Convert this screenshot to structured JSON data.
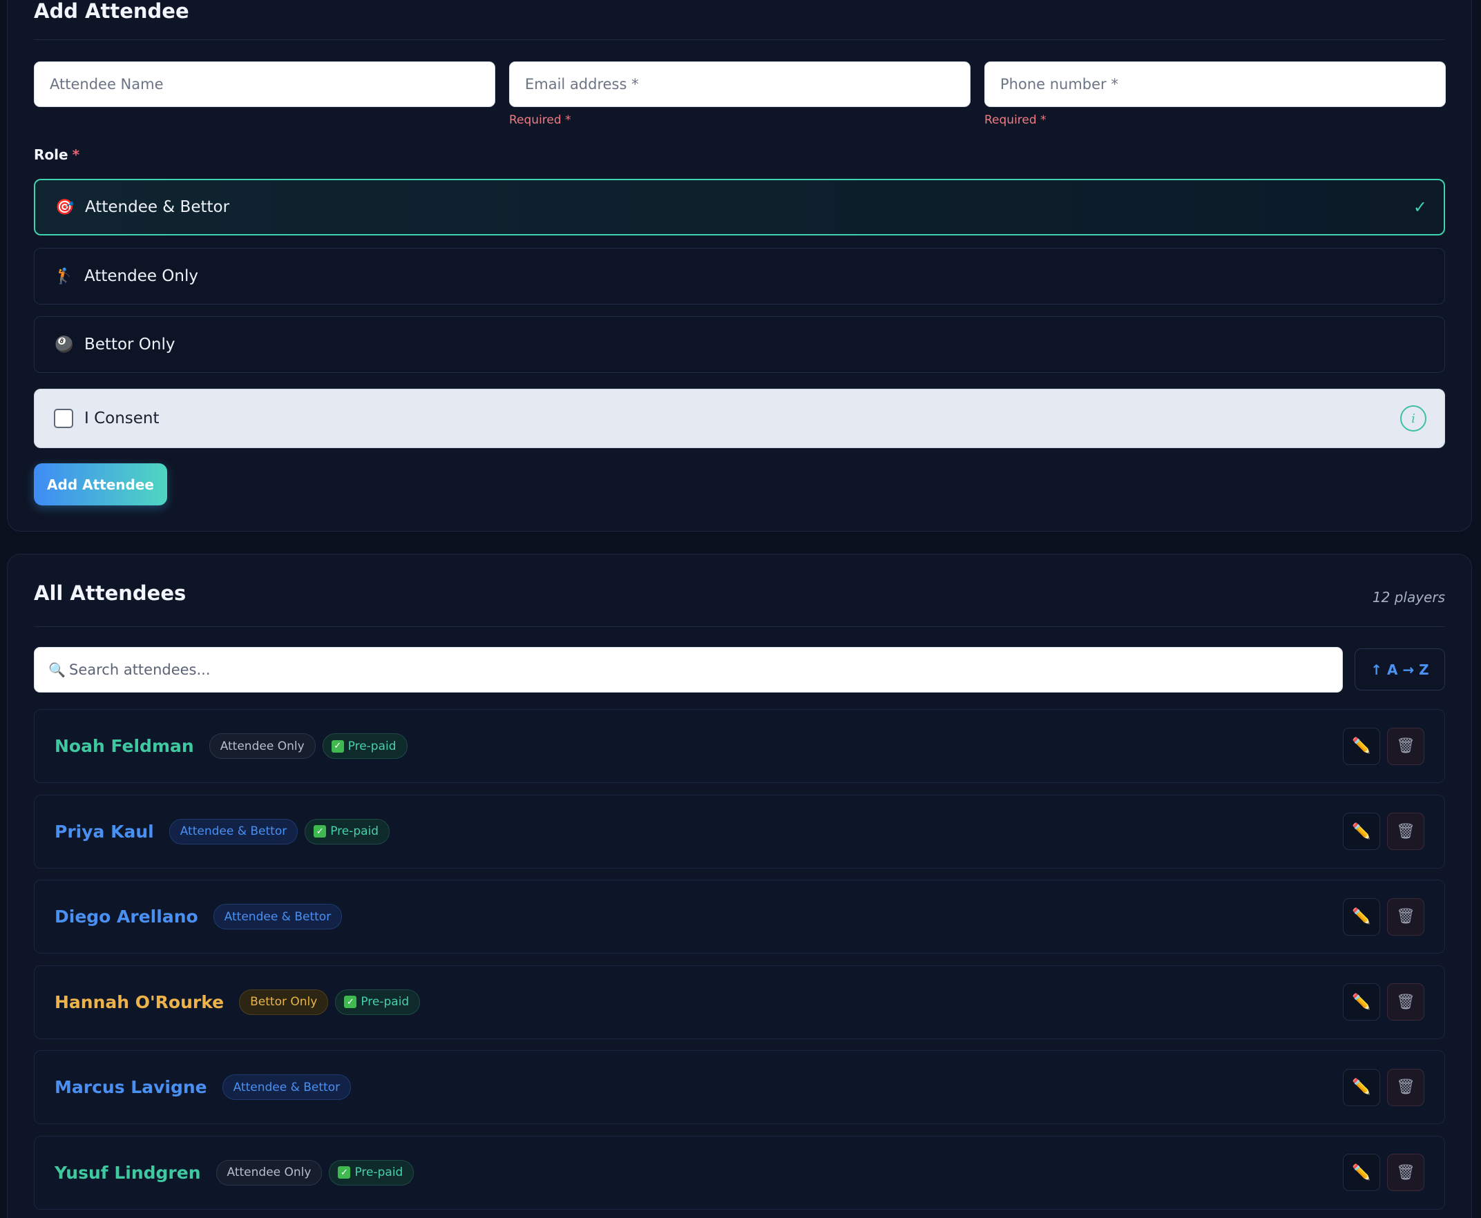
{
  "add_form": {
    "title": "Add Attendee",
    "name_placeholder": "Attendee Name",
    "email_placeholder": "Email address *",
    "phone_placeholder": "Phone number *",
    "email_hint": "Required *",
    "phone_hint": "Required *",
    "role_label": "Role",
    "role_required_mark": "*",
    "roles": [
      {
        "emoji": "🎯",
        "label": "Attendee & Bettor",
        "selected": true,
        "check": "✓"
      },
      {
        "emoji": "🏌",
        "label": "Attendee Only",
        "selected": false
      },
      {
        "emoji": "🎱",
        "label": "Bettor Only",
        "selected": false
      }
    ],
    "consent_label": "I Consent",
    "info_glyph": "i",
    "submit_label": "Add Attendee"
  },
  "list": {
    "title": "All Attendees",
    "count_text": "12 players",
    "search_icon": "🔍",
    "search_placeholder": "Search attendees...",
    "sort_label": "↑ A → Z",
    "edit_icon": "✏️",
    "delete_icon": "🗑",
    "prepaid_check": "✓",
    "attendees": [
      {
        "name": "Noah Feldman",
        "role": "Attendee Only",
        "role_class": "attendee-only",
        "name_color": "#3ec9a0",
        "prepaid": true,
        "prepaid_label": "Pre-paid"
      },
      {
        "name": "Priya Kaul",
        "role": "Attendee & Bettor",
        "role_class": "attendee-bettor",
        "name_color": "#4a8ff2",
        "prepaid": true,
        "prepaid_label": "Pre-paid"
      },
      {
        "name": "Diego Arellano",
        "role": "Attendee & Bettor",
        "role_class": "attendee-bettor",
        "name_color": "#4a8ff2",
        "prepaid": false
      },
      {
        "name": "Hannah O'Rourke",
        "role": "Bettor Only",
        "role_class": "bettor-only",
        "name_color": "#edb34a",
        "prepaid": true,
        "prepaid_label": "Pre-paid"
      },
      {
        "name": "Marcus Lavigne",
        "role": "Attendee & Bettor",
        "role_class": "attendee-bettor",
        "name_color": "#4a8ff2",
        "prepaid": false
      },
      {
        "name": "Yusuf Lindgren",
        "role": "Attendee Only",
        "role_class": "attendee-only",
        "name_color": "#3ec9a0",
        "prepaid": true,
        "prepaid_label": "Pre-paid"
      }
    ]
  }
}
